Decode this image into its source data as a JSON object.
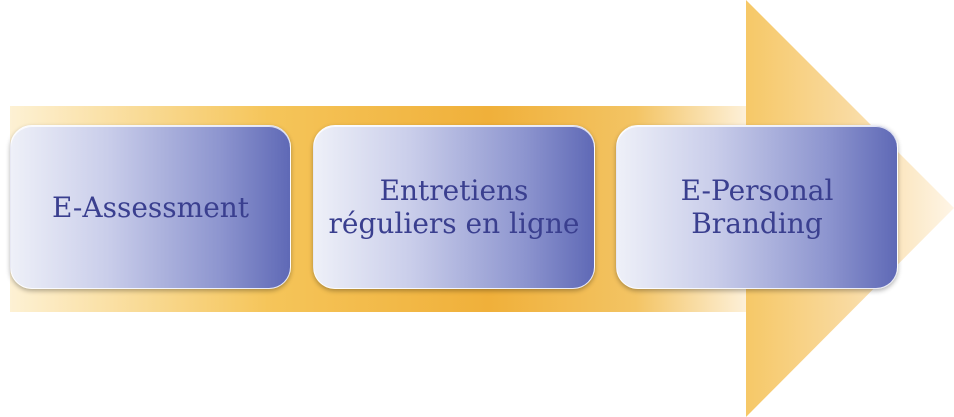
{
  "colors": {
    "arrow": "#f0b43a",
    "box_text": "#3a3f8f",
    "box_light": "#eef0f8",
    "box_dark": "#5f69b6"
  },
  "steps": [
    {
      "label": "E-Assessment"
    },
    {
      "label": "Entretiens\nréguliers en ligne"
    },
    {
      "label": "E-Personal\nBranding"
    }
  ]
}
